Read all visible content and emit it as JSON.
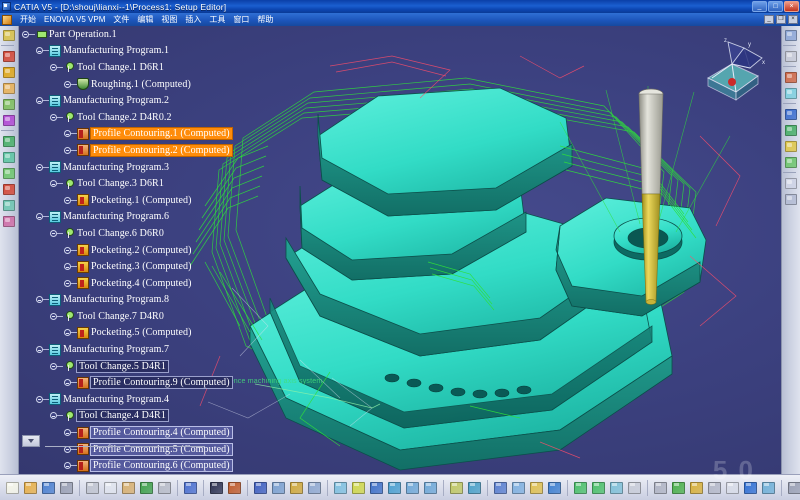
{
  "window": {
    "title": "CATIA V5 - [D:\\shouj\\lianxi--1\\Process1: Setup Editor]",
    "minimize_label": "_",
    "maximize_label": "□",
    "close_label": "×",
    "mdi_minimize": "_",
    "mdi_restore": "❐",
    "mdi_close": "×",
    "app_icon": "catia-app-icon"
  },
  "menubar": {
    "start_icon": "start-menu-icon",
    "items": [
      {
        "label": "开始"
      },
      {
        "label": "ENOVIA V5 VPM"
      },
      {
        "label": "文件"
      },
      {
        "label": "编辑"
      },
      {
        "label": "视图"
      },
      {
        "label": "插入"
      },
      {
        "label": "工具"
      },
      {
        "label": "窗口"
      },
      {
        "label": "帮助"
      }
    ]
  },
  "left_toolbar": {
    "items": [
      {
        "name": "machining-axis-icon",
        "color": "#d9c24a"
      },
      {
        "name": "roughing-operation-icon",
        "color": "#d44a3a"
      },
      {
        "name": "pocketing-operation-icon",
        "color": "#e0a81c"
      },
      {
        "name": "profile-contouring-icon",
        "color": "#e8b25a"
      },
      {
        "name": "sweeping-operation-icon",
        "color": "#7fbf5f"
      },
      {
        "name": "drilling-operation-icon",
        "color": "#b24ad4"
      },
      {
        "name": "tool-change-icon",
        "color": "#4ab06a"
      },
      {
        "name": "auxiliary-operation-icon",
        "color": "#5ec6a4"
      },
      {
        "name": "machining-feature-icon",
        "color": "#6fc66f"
      },
      {
        "name": "tool-path-replay-icon",
        "color": "#d44a3a"
      },
      {
        "name": "geometry-area-icon",
        "color": "#6fc6b2"
      },
      {
        "name": "rework-area-icon",
        "color": "#cf6fa8"
      }
    ]
  },
  "right_toolbar": {
    "items": [
      {
        "name": "machining-process-icon",
        "color": "#8fa8d8"
      },
      {
        "name": "nc-output-icon",
        "color": "#c8cbd8"
      },
      {
        "name": "tool-catalog-icon",
        "color": "#d06a4a"
      },
      {
        "name": "program-list-icon",
        "color": "#7fd0e0"
      },
      {
        "name": "material-removal-icon",
        "color": "#3e6fd0"
      },
      {
        "name": "photo-simulation-icon",
        "color": "#4ab06a"
      },
      {
        "name": "video-simulation-icon",
        "color": "#e0c84a"
      },
      {
        "name": "analysis-icon",
        "color": "#6fc66f"
      },
      {
        "name": "apt-source-icon",
        "color": "#cfd4e6"
      },
      {
        "name": "cl-file-icon",
        "color": "#b4bcd4"
      }
    ]
  },
  "tree": {
    "root_label": "Part Operation.1",
    "rows": [
      {
        "label": "Part Operation.1",
        "indent": 0,
        "icon": "part-operation-icon",
        "selection": "none",
        "expander": true
      },
      {
        "label": "Manufacturing Program.1",
        "indent": 1,
        "icon": "manufacturing-program-icon",
        "selection": "none",
        "expander": true
      },
      {
        "label": "Tool Change.1    D6R1",
        "indent": 2,
        "icon": "tool-change-icon",
        "selection": "none",
        "expander": true
      },
      {
        "label": "Roughing.1  (Computed)",
        "indent": 3,
        "icon": "roughing-icon",
        "selection": "none",
        "expander": true
      },
      {
        "label": "Manufacturing Program.2",
        "indent": 1,
        "icon": "manufacturing-program-icon",
        "selection": "none",
        "expander": true
      },
      {
        "label": "Tool Change.2    D4R0.2",
        "indent": 2,
        "icon": "tool-change-icon",
        "selection": "none",
        "expander": true
      },
      {
        "label": "Profile Contouring.1  (Computed)",
        "indent": 3,
        "icon": "profile-contouring-icon",
        "selection": "orange",
        "expander": true
      },
      {
        "label": "Profile Contouring.2  (Computed)",
        "indent": 3,
        "icon": "profile-contouring-icon",
        "selection": "orange",
        "expander": true
      },
      {
        "label": "Manufacturing Program.3",
        "indent": 1,
        "icon": "manufacturing-program-icon",
        "selection": "none",
        "expander": true
      },
      {
        "label": "Tool Change.3    D6R1",
        "indent": 2,
        "icon": "tool-change-icon",
        "selection": "none",
        "expander": true
      },
      {
        "label": "Pocketing.1  (Computed)",
        "indent": 3,
        "icon": "pocketing-icon",
        "selection": "none",
        "expander": true
      },
      {
        "label": "Manufacturing Program.6",
        "indent": 1,
        "icon": "manufacturing-program-icon",
        "selection": "none",
        "expander": true
      },
      {
        "label": "Tool Change.6    D6R0",
        "indent": 2,
        "icon": "tool-change-icon",
        "selection": "none",
        "expander": true
      },
      {
        "label": "Pocketing.2  (Computed)",
        "indent": 3,
        "icon": "pocketing-icon",
        "selection": "none",
        "expander": true
      },
      {
        "label": "Pocketing.3  (Computed)",
        "indent": 3,
        "icon": "pocketing-icon",
        "selection": "none",
        "expander": true
      },
      {
        "label": "Pocketing.4  (Computed)",
        "indent": 3,
        "icon": "pocketing-icon",
        "selection": "none",
        "expander": true
      },
      {
        "label": "Manufacturing Program.8",
        "indent": 1,
        "icon": "manufacturing-program-icon",
        "selection": "none",
        "expander": true
      },
      {
        "label": "Tool Change.7    D4R0",
        "indent": 2,
        "icon": "tool-change-icon",
        "selection": "none",
        "expander": true
      },
      {
        "label": "Pocketing.5  (Computed)",
        "indent": 3,
        "icon": "pocketing-icon",
        "selection": "none",
        "expander": true
      },
      {
        "label": "Manufacturing Program.7",
        "indent": 1,
        "icon": "manufacturing-program-icon",
        "selection": "none",
        "expander": true
      },
      {
        "label": "Tool Change.5    D4R1",
        "indent": 2,
        "icon": "tool-change-icon",
        "selection": "dark",
        "expander": true
      },
      {
        "label": "Profile Contouring.9  (Computed)",
        "indent": 3,
        "icon": "profile-contouring-icon",
        "selection": "dark",
        "expander": true
      },
      {
        "label": "Manufacturing Program.4",
        "indent": 1,
        "icon": "manufacturing-program-icon",
        "selection": "none",
        "expander": true
      },
      {
        "label": "Tool Change.4    D4R1",
        "indent": 2,
        "icon": "tool-change-icon",
        "selection": "dark",
        "expander": true
      },
      {
        "label": "Profile Contouring.4  (Computed)",
        "indent": 3,
        "icon": "profile-contouring-icon",
        "selection": "light",
        "expander": true
      },
      {
        "label": "Profile Contouring.5  (Computed)",
        "indent": 3,
        "icon": "profile-contouring-icon",
        "selection": "light",
        "expander": true
      },
      {
        "label": "Profile Contouring.6  (Computed)",
        "indent": 3,
        "icon": "profile-contouring-icon",
        "selection": "light",
        "expander": true
      }
    ]
  },
  "viewport": {
    "annotation": "edit reference machining axis system",
    "compass_labels": {
      "z": "z",
      "y": "y",
      "x": "x"
    },
    "part_color": "#3fe8d0",
    "toolpath_color": "#2ee03a",
    "background_color": "#3e4280",
    "tool_shank_color": "#cfcfc4",
    "tool_flute_color": "#d6c24a"
  },
  "bottom_toolbar": {
    "items": [
      {
        "name": "new-document-icon",
        "color": "#f5f5e8"
      },
      {
        "name": "open-document-icon",
        "color": "#e8b04a"
      },
      {
        "name": "save-document-icon",
        "color": "#4a7fd0"
      },
      {
        "name": "print-icon",
        "color": "#9aa0b4"
      },
      {
        "name": "cut-icon",
        "color": "#c0c4d0"
      },
      {
        "name": "copy-icon",
        "color": "#e0e4ee"
      },
      {
        "name": "paste-icon",
        "color": "#d8b070"
      },
      {
        "name": "undo-icon",
        "color": "#3ea04a"
      },
      {
        "name": "redo-icon",
        "color": "#b8bcc8"
      },
      {
        "name": "whats-this-help-icon",
        "color": "#4a6fd0"
      },
      {
        "name": "formula-icon",
        "color": "#2b3050"
      },
      {
        "name": "comment-icon",
        "color": "#c05a2a"
      },
      {
        "name": "catalog-browser-icon",
        "color": "#3e5fc0"
      },
      {
        "name": "power-input-icon",
        "color": "#7aa0d0"
      },
      {
        "name": "lock-icon",
        "color": "#d0a83a"
      },
      {
        "name": "measure-item-icon",
        "color": "#8fa8d0"
      },
      {
        "name": "fit-all-in-icon",
        "color": "#7fc0e0"
      },
      {
        "name": "normal-view-icon",
        "color": "#d0d84a"
      },
      {
        "name": "pan-icon",
        "color": "#3e70c8"
      },
      {
        "name": "rotate-icon",
        "color": "#4a9fd0"
      },
      {
        "name": "zoom-in-icon",
        "color": "#6fa8d8"
      },
      {
        "name": "zoom-out-icon",
        "color": "#6fa8d8"
      },
      {
        "name": "look-at-icon",
        "color": "#c0c864"
      },
      {
        "name": "view-mode-icon",
        "color": "#4aa0c8"
      },
      {
        "name": "iso-view-icon",
        "color": "#5a7fd0"
      },
      {
        "name": "front-view-icon",
        "color": "#7fb0e0"
      },
      {
        "name": "named-view-icon",
        "color": "#e0c050"
      },
      {
        "name": "info-icon",
        "color": "#3e7fd0"
      },
      {
        "name": "render-style-icon",
        "color": "#4ac06a"
      },
      {
        "name": "hide-show-icon",
        "color": "#4ac06a"
      },
      {
        "name": "swap-visible-icon",
        "color": "#7fc0d8"
      },
      {
        "name": "table-icon",
        "color": "#c8ccd8"
      },
      {
        "name": "pencil-sketch-icon",
        "color": "#b0b4c4"
      },
      {
        "name": "globe-icon",
        "color": "#4ab04a"
      },
      {
        "name": "key-icon",
        "color": "#d8b03a"
      },
      {
        "name": "scissors-icon",
        "color": "#b4b8c8"
      },
      {
        "name": "grid-snap-icon",
        "color": "#d8dce8"
      },
      {
        "name": "blue-bar-icon",
        "color": "#2f6fd4"
      },
      {
        "name": "sketch-analysis-icon",
        "color": "#6fb0d8"
      },
      {
        "name": "distance-icon",
        "color": "#9aa0b4"
      },
      {
        "name": "apply-material-icon",
        "color": "#5a5f78"
      },
      {
        "name": "tool-path-edit-icon",
        "color": "#3ea04a"
      },
      {
        "name": "point-icon",
        "color": "#4a8fd0"
      },
      {
        "name": "line-icon",
        "color": "#3e9f5a"
      },
      {
        "name": "plane-icon",
        "color": "#5a7fd0"
      },
      {
        "name": "axis-icon",
        "color": "#c05a2a"
      }
    ]
  },
  "watermark": {
    "text": "5 0"
  }
}
